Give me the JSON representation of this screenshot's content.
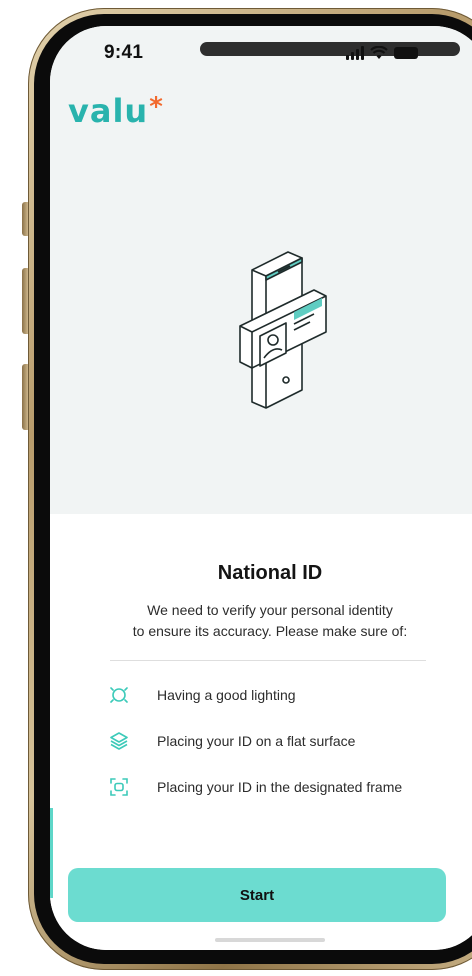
{
  "status_bar": {
    "time": "9:41"
  },
  "brand": {
    "logo_text": "valu",
    "logo_mark": "*",
    "color_primary": "#29b3ad",
    "color_accent": "#f26a2e"
  },
  "illustration": {
    "icon": "phone-id-card-icon"
  },
  "card": {
    "title": "National ID",
    "description_line1": "We need to verify your personal identity",
    "description_line2": "to ensure its accuracy. Please make sure of:",
    "tips": [
      {
        "icon": "lighting-icon",
        "label": "Having a good lighting"
      },
      {
        "icon": "layers-icon",
        "label": "Placing your ID on a flat surface"
      },
      {
        "icon": "frame-icon",
        "label": "Placing your ID in the designated frame"
      }
    ]
  },
  "actions": {
    "start_label": "Start",
    "button_color": "#6cdcd0"
  }
}
